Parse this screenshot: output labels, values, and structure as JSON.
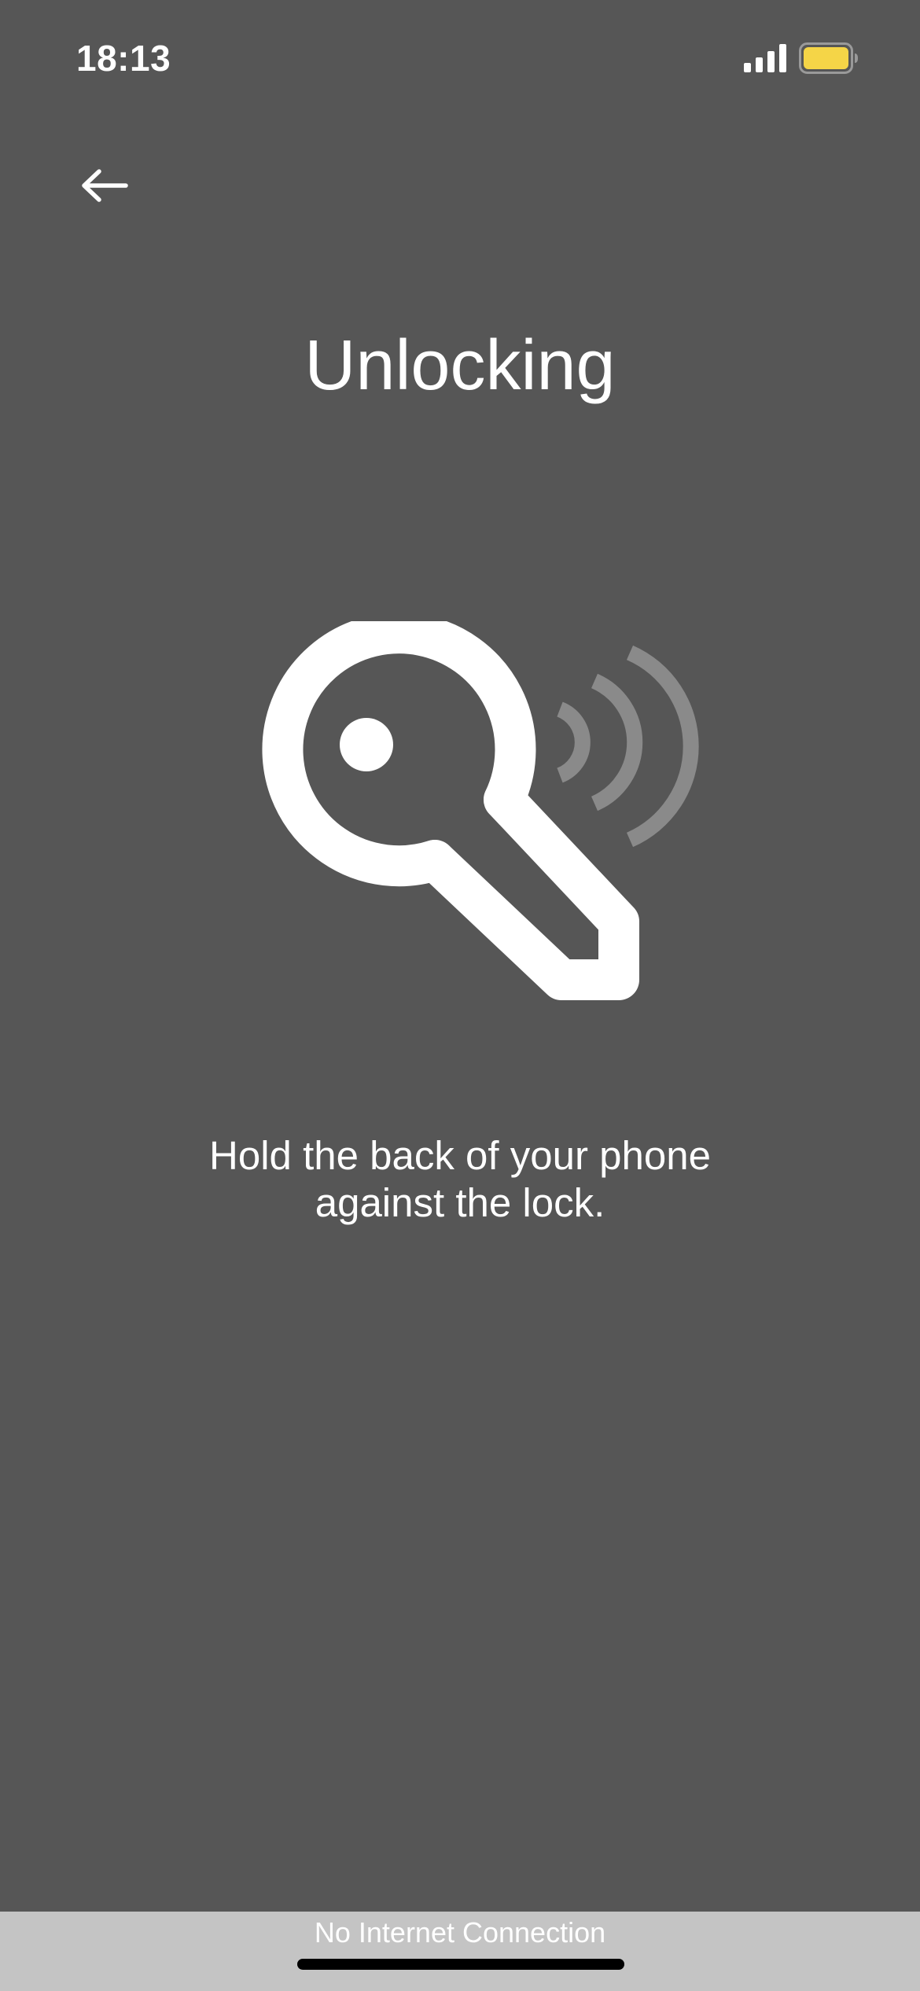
{
  "status_bar": {
    "time": "18:13",
    "signal_icon": "signal-strength-icon",
    "battery_icon": "battery-icon",
    "battery_color": "#f5d547"
  },
  "navigation": {
    "back_icon": "arrow-left-icon"
  },
  "title": "Unlocking",
  "illustration": {
    "icon": "key-nfc-icon",
    "key_color": "#ffffff",
    "wave_color": "#8a8a8a"
  },
  "instruction": {
    "line1": "Hold the back of your phone",
    "line2": "against the lock."
  },
  "network_banner": {
    "text": "No Internet Connection",
    "background": "#c4c4c4"
  },
  "colors": {
    "background": "#565656",
    "text": "#ffffff"
  }
}
